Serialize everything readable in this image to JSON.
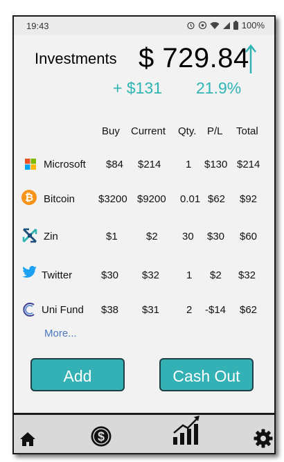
{
  "status_bar": {
    "time": "19:43",
    "battery": "100%"
  },
  "header": {
    "title": "Investments",
    "total": "$ 729.84",
    "change_amount": "+ $131",
    "change_percent": "21.9%"
  },
  "table": {
    "columns": [
      "Buy",
      "Current",
      "Qty.",
      "P/L",
      "Total"
    ],
    "rows": [
      {
        "name": "Microsoft",
        "buy": "$84",
        "current": "$214",
        "qty": "1",
        "pl": "$130",
        "total": "$214"
      },
      {
        "name": "Bitcoin",
        "buy": "$3200",
        "current": "$9200",
        "qty": "0.01",
        "pl": "$62",
        "total": "$92"
      },
      {
        "name": "Zin",
        "buy": "$1",
        "current": "$2",
        "qty": "30",
        "pl": "$30",
        "total": "$60"
      },
      {
        "name": "Twitter",
        "buy": "$30",
        "current": "$32",
        "qty": "1",
        "pl": "$2",
        "total": "$32"
      },
      {
        "name": "Uni Fund",
        "buy": "$38",
        "current": "$31",
        "qty": "2",
        "pl": "-$14",
        "total": "$62"
      }
    ]
  },
  "more_link": "More...",
  "buttons": {
    "add": "Add",
    "cash_out": "Cash Out"
  },
  "icons": {
    "rows": [
      "microsoft-icon",
      "bitcoin-icon",
      "zin-icon",
      "twitter-icon",
      "uni-fund-icon"
    ],
    "nav": [
      "home-icon",
      "dollar-icon",
      "chart-growth-icon",
      "settings-icon"
    ]
  },
  "colors": {
    "accent": "#33b1b4",
    "positive_text": "#2fb3b3",
    "link": "#4a78c0",
    "background": "#f2f2f2"
  }
}
